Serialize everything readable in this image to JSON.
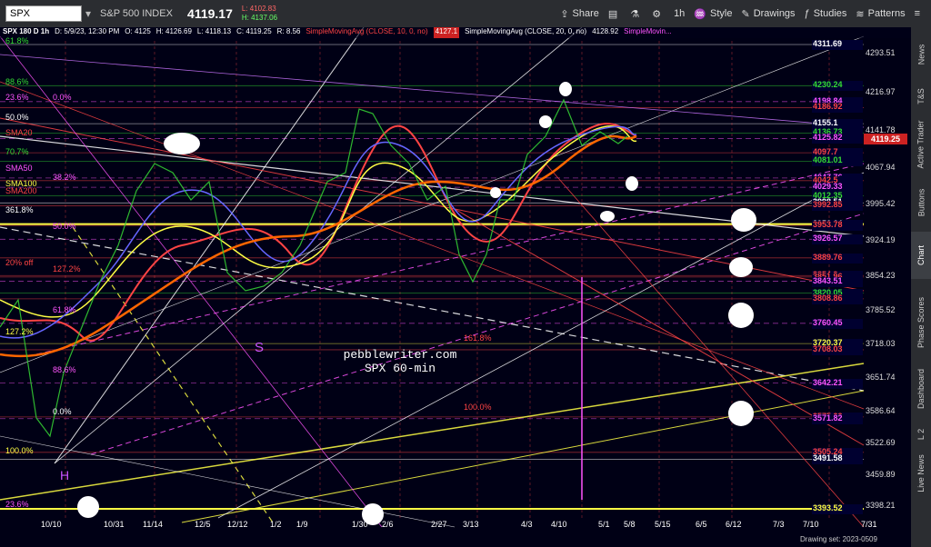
{
  "toolbar": {
    "symbol": "SPX",
    "name": "S&P 500 INDEX",
    "price": "4119.17",
    "low": "L: 4102.83",
    "high": "H: 4137.06",
    "buttons": [
      "Share",
      "1h",
      "Style",
      "Drawings",
      "Studies",
      "Patterns"
    ]
  },
  "infobar": {
    "title": "SPX 180 D 1h",
    "date": "D: 5/9/23, 12:30 PM",
    "open": "O: 4125",
    "high": "H: 4126.69",
    "low": "L: 4118.13",
    "close": "C: 4119.25",
    "range": "R: 8.56",
    "sma10": "SimpleMovingAvg (CLOSE, 10, 0, no)",
    "sma10_val": "4127.1",
    "sma20": "SimpleMovingAvg (CLOSE, 20, 0, no)",
    "sma20_val": "4128.92",
    "sma_more": "SimpleMovin..."
  },
  "sidebar": {
    "tabs": [
      "News",
      "T&S",
      "Active Trader",
      "Buttons",
      "Chart",
      "Phase Scores",
      "Dashboard",
      "L 2",
      "Live News"
    ],
    "active": "Chart"
  },
  "watermark": {
    "line1": "pebblewriter.com",
    "line2": "SPX 60-min"
  },
  "price_axis": [
    "4293.51",
    "4216.97",
    "4141.78",
    "4067.94",
    "3995.42",
    "3924.19",
    "3854.23",
    "3785.52",
    "3718.03",
    "3651.74",
    "3586.64",
    "3522.69",
    "3459.89",
    "3398.21"
  ],
  "current_price": "4119.25",
  "price_annotations": [
    {
      "text": "4311.69",
      "color": "#ffffff"
    },
    {
      "text": "4230.24",
      "color": "#33dd33"
    },
    {
      "text": "4198.84",
      "color": "#ff55ff"
    },
    {
      "text": "4186.92",
      "color": "#ff4444"
    },
    {
      "text": "4155.1",
      "color": "#ffffff"
    },
    {
      "text": "4136.73",
      "color": "#33dd33"
    },
    {
      "text": "4125.82",
      "color": "#ff55ff"
    },
    {
      "text": "4097.7",
      "color": "#ff4444"
    },
    {
      "text": "4081.01",
      "color": "#33dd33"
    },
    {
      "text": "4047.76",
      "color": "#ff55ff"
    },
    {
      "text": "4042.5",
      "color": "#ff4444"
    },
    {
      "text": "4029.33",
      "color": "#ff55ff"
    },
    {
      "text": "4012.35",
      "color": "#33dd33"
    },
    {
      "text": "3998.51",
      "color": "#ffffff"
    },
    {
      "text": "3992.85",
      "color": "#ff4444"
    },
    {
      "text": "3956.64",
      "color": "#ffffff"
    },
    {
      "text": "3953.78",
      "color": "#ff4444"
    },
    {
      "text": "3926.57",
      "color": "#ff55ff"
    },
    {
      "text": "3889.76",
      "color": "#ff4444"
    },
    {
      "text": "3854.9",
      "color": "#ff4444"
    },
    {
      "text": "3851.96",
      "color": "#ff4444"
    },
    {
      "text": "3843.51",
      "color": "#ff55ff"
    },
    {
      "text": "3820.05",
      "color": "#33dd33"
    },
    {
      "text": "3808.86",
      "color": "#ff4444"
    },
    {
      "text": "3760.45",
      "color": "#ff55ff"
    },
    {
      "text": "3720.37",
      "color": "#ffff44"
    },
    {
      "text": "3708.03",
      "color": "#ff4444"
    },
    {
      "text": "3642.21",
      "color": "#ff55ff"
    },
    {
      "text": "3575.22",
      "color": "#ff4444"
    },
    {
      "text": "3571.82",
      "color": "#ff55ff"
    },
    {
      "text": "3505.24",
      "color": "#ff4444"
    },
    {
      "text": "3491.58",
      "color": "#ffffff"
    },
    {
      "text": "3393.52",
      "color": "#ffff44"
    }
  ],
  "date_axis": [
    "10/10",
    "10/31",
    "11/14",
    "12/5",
    "12/12",
    "1/2",
    "1/9",
    "1/30",
    "2/6",
    "2/27",
    "3/13",
    "4/3",
    "4/10",
    "5/1",
    "5/8",
    "5/15",
    "6/5",
    "6/12",
    "7/3",
    "7/10",
    "7/31"
  ],
  "fib_labels": [
    {
      "text": "61.8%",
      "color": "#33dd33"
    },
    {
      "text": "88.6%",
      "color": "#33dd33"
    },
    {
      "text": "23.6%",
      "color": "#ff55ff"
    },
    {
      "text": "0.0%",
      "color": "#ff55ff"
    },
    {
      "text": "50.0%",
      "color": "#ffffff"
    },
    {
      "text": "SMA20",
      "color": "#ff4444"
    },
    {
      "text": "70.7%",
      "color": "#33dd33"
    },
    {
      "text": "SMA50",
      "color": "#ff55ff"
    },
    {
      "text": "SMA100",
      "color": "#ffff44"
    },
    {
      "text": "SMA200",
      "color": "#ff4444"
    },
    {
      "text": "361.8%",
      "color": "#ffffff"
    },
    {
      "text": "20% off",
      "color": "#ff4444"
    },
    {
      "text": "61.8%",
      "color": "#ff55ff"
    },
    {
      "text": "127.2%",
      "color": "#ffff44"
    },
    {
      "text": "88.6%",
      "color": "#ff55ff"
    },
    {
      "text": "0.0%",
      "color": "#ffffff"
    },
    {
      "text": "100.0%",
      "color": "#ffff44"
    },
    {
      "text": "23.6%",
      "color": "#ff55ff"
    },
    {
      "text": "38.2%",
      "color": "#ff55ff"
    },
    {
      "text": "50.0%",
      "color": "#ff55ff"
    },
    {
      "text": "127.2%",
      "color": "#ff4444"
    },
    {
      "text": "161.8%",
      "color": "#ff4444"
    },
    {
      "text": "100.0%",
      "color": "#ff4444"
    }
  ],
  "markers": [
    "S",
    "H"
  ],
  "drawing_set": "Drawing set: 2023-0509"
}
